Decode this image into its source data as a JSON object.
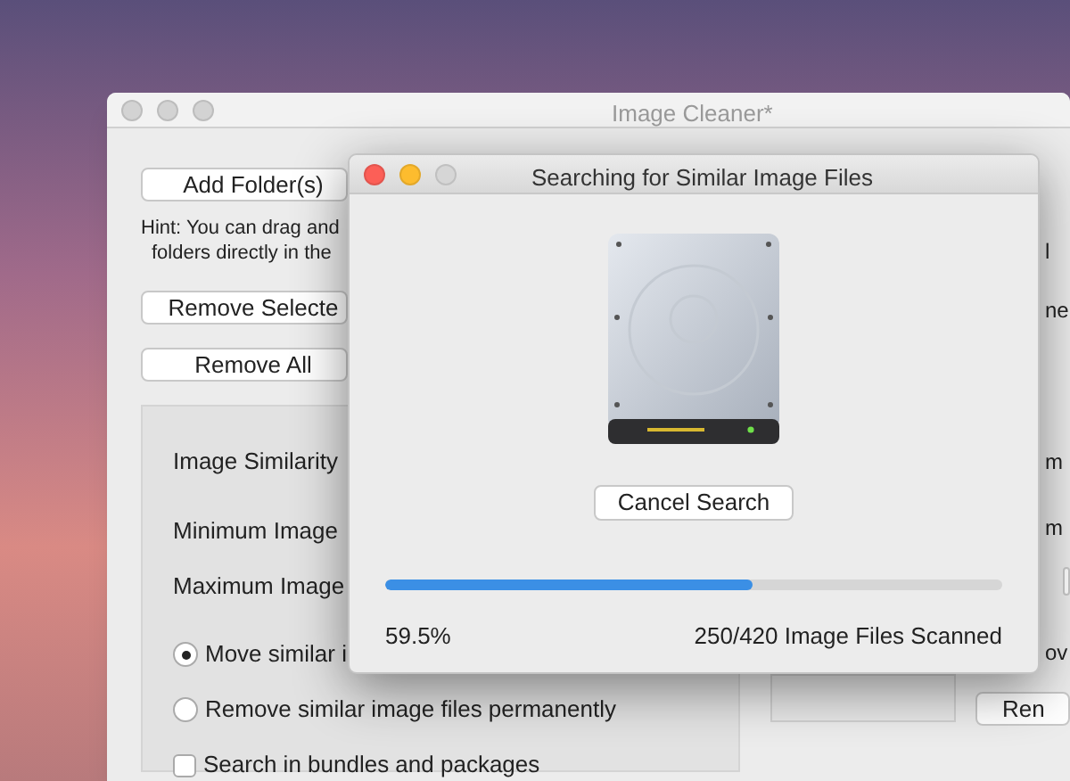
{
  "main_window": {
    "title": "Image Cleaner*",
    "buttons": [
      "Add Folder(s)",
      "Remove Selecte",
      "Remove All"
    ],
    "hint": [
      "Hint: You can drag and",
      "folders directly in the"
    ],
    "settings": [
      {
        "kind": "label",
        "text": "Image Similarity"
      },
      {
        "kind": "label",
        "text": "Minimum Image"
      },
      {
        "kind": "label",
        "text": "Maximum Image"
      },
      {
        "kind": "radio",
        "text": "Move similar i",
        "selected": true
      },
      {
        "kind": "radio",
        "text": "Remove similar image files permanently",
        "selected": false
      },
      {
        "kind": "checkbox",
        "text": "Search in bundles and packages",
        "checked": false
      }
    ],
    "right_column": [
      "l",
      "ne",
      "m",
      "m",
      "ov"
    ],
    "right_button": "Ren"
  },
  "dialog": {
    "title": "Searching for Similar Image Files",
    "cancel_button": "Cancel Search",
    "progress": {
      "level": 0.595,
      "percent": "59.5%",
      "status": "250/420 Image Files Scanned"
    }
  }
}
